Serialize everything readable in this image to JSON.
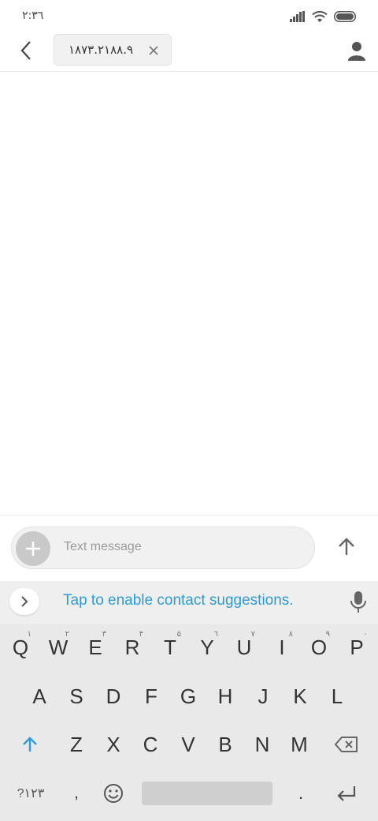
{
  "status": {
    "time": "۲:۳٦",
    "icons": [
      "signal-icon",
      "wifi-icon",
      "battery-icon"
    ]
  },
  "appbar": {
    "back_icon": "back-arrow-icon",
    "recipient": "۱۸۷۳.۲۱۸۸.۹",
    "remove_icon": "close-icon",
    "contact_icon": "person-icon"
  },
  "compose": {
    "add_icon": "plus-icon",
    "placeholder": "Text message",
    "send_icon": "arrow-up-icon"
  },
  "keyboard": {
    "suggestion": "Tap to enable contact suggestions.",
    "accent_color": "#2f9cd8",
    "row1": [
      {
        "label": "Q",
        "sub": "۱"
      },
      {
        "label": "W",
        "sub": "۲"
      },
      {
        "label": "E",
        "sub": "۳"
      },
      {
        "label": "R",
        "sub": "۴"
      },
      {
        "label": "T",
        "sub": "۵"
      },
      {
        "label": "Y",
        "sub": "٦"
      },
      {
        "label": "U",
        "sub": "۷"
      },
      {
        "label": "I",
        "sub": "۸"
      },
      {
        "label": "O",
        "sub": "۹"
      },
      {
        "label": "P",
        "sub": "۰"
      }
    ],
    "row2": [
      "A",
      "S",
      "D",
      "F",
      "G",
      "H",
      "J",
      "K",
      "L"
    ],
    "row3": [
      "Z",
      "X",
      "C",
      "V",
      "B",
      "N",
      "M"
    ],
    "symbols_key": "?۱۲۳",
    "comma_key": ",",
    "period_key": "."
  }
}
